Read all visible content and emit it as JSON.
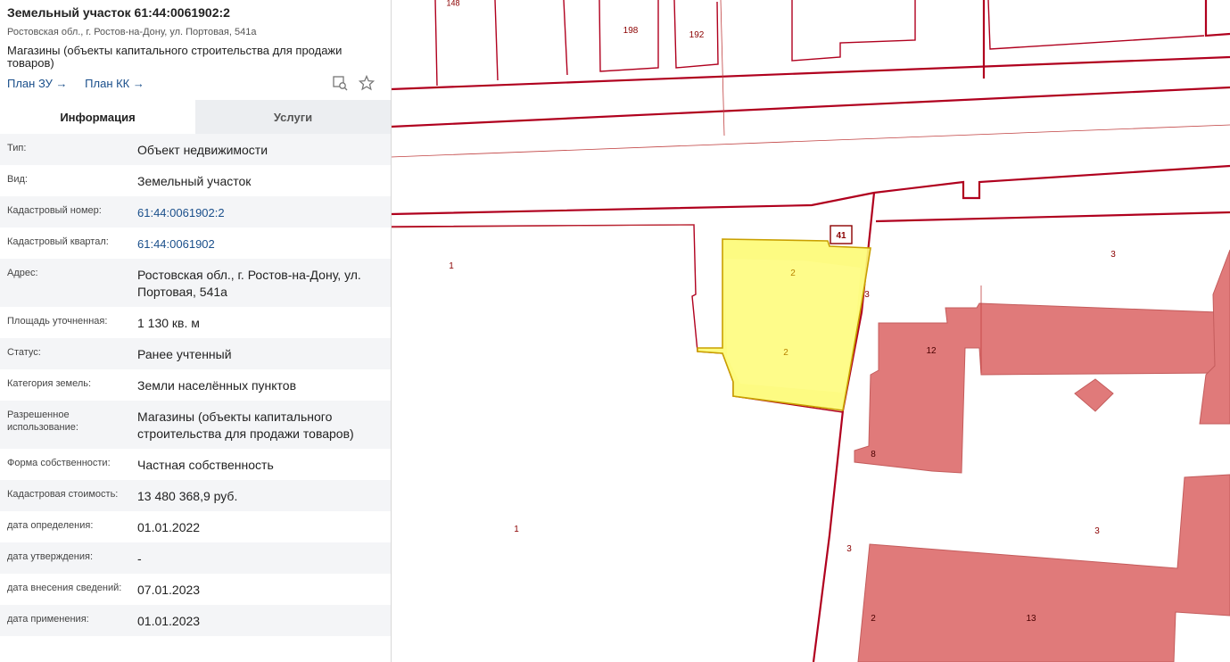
{
  "header": {
    "title": "Земельный участок 61:44:0061902:2",
    "address": "Ростовская обл., г. Ростов-на-Дону, ул. Портовая, 541а",
    "purpose": "Магазины (объекты капитального строительства для продажи товаров)",
    "plan_zu": "План ЗУ →",
    "plan_kk": "План КК →"
  },
  "tabs": {
    "info": "Информация",
    "services": "Услуги"
  },
  "rows": [
    {
      "label": "Тип:",
      "value": "Объект недвижимости"
    },
    {
      "label": "Вид:",
      "value": "Земельный участок"
    },
    {
      "label": "Кадастровый номер:",
      "value": "61:44:0061902:2"
    },
    {
      "label": "Кадастровый квартал:",
      "value": "61:44:0061902"
    },
    {
      "label": "Адрес:",
      "value": "Ростовская обл., г. Ростов-на-Дону, ул. Портовая, 541а"
    },
    {
      "label": "Площадь уточненная:",
      "value": "1 130 кв. м"
    },
    {
      "label": "Статус:",
      "value": "Ранее учтенный"
    },
    {
      "label": "Категория земель:",
      "value": "Земли населённых пунктов"
    },
    {
      "label": "Разрешенное использование:",
      "value": "Магазины (объекты капитального строительства для продажи товаров)"
    },
    {
      "label": "Форма собственности:",
      "value": "Частная собственность"
    },
    {
      "label": "Кадастровая стоимость:",
      "value": "13 480 368,9 руб."
    },
    {
      "label": "дата определения:",
      "value": "01.01.2022"
    },
    {
      "label": "дата утверждения:",
      "value": "-"
    },
    {
      "label": "дата внесения сведений:",
      "value": "07.01.2023"
    },
    {
      "label": "дата применения:",
      "value": "01.01.2023"
    }
  ],
  "map": {
    "labels": {
      "l198": "198",
      "l192": "192",
      "l41": "41",
      "l1a": "1",
      "l1b": "1",
      "l2a": "2",
      "l2b": "2",
      "l3a": "3",
      "l3b": "3",
      "l3c": "3",
      "l3d": "3",
      "l12": "12",
      "l13": "13",
      "l8": "8",
      "l2c": "2",
      "l148": "148"
    },
    "colors": {
      "boundary": "#b0001e",
      "building": "#e07a7a",
      "selected_fill": "#fdfb77",
      "selected_stroke": "#c9a000"
    }
  }
}
